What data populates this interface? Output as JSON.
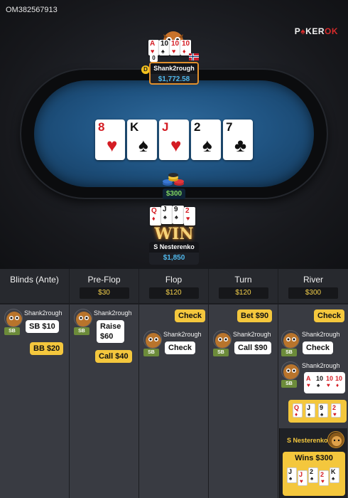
{
  "hand_id": "OM382567913",
  "brand": {
    "part1": "P",
    "part2": "KER",
    "ok": "OK"
  },
  "board": [
    {
      "rank": "8",
      "suit": "♥",
      "color": "red"
    },
    {
      "rank": "K",
      "suit": "♠",
      "color": "black"
    },
    {
      "rank": "J",
      "suit": "♥",
      "color": "red"
    },
    {
      "rank": "2",
      "suit": "♠",
      "color": "black"
    },
    {
      "rank": "7",
      "suit": "♣",
      "color": "black"
    }
  ],
  "villain": {
    "name": "Shank2rough",
    "stack": "$1,772.58",
    "dealer_label": "D",
    "cards": [
      {
        "rank": "A",
        "suit": "♥",
        "color": "red"
      },
      {
        "rank": "10",
        "suit": "♠",
        "color": "black"
      },
      {
        "rank": "10",
        "suit": "♥",
        "color": "red"
      },
      {
        "rank": "10",
        "suit": "♦",
        "color": "red"
      }
    ]
  },
  "hero": {
    "name": "S Nesterenko",
    "stack": "$1,850",
    "win_label": "WIN",
    "cards": [
      {
        "rank": "Q",
        "suit": "♦",
        "color": "red"
      },
      {
        "rank": "J",
        "suit": "♠",
        "color": "black"
      },
      {
        "rank": "9",
        "suit": "♠",
        "color": "black"
      },
      {
        "rank": "2",
        "suit": "♥",
        "color": "red"
      }
    ]
  },
  "pot": "$300",
  "history": {
    "columns": [
      {
        "title": "Blinds (Ante)",
        "pot": ""
      },
      {
        "title": "Pre-Flop",
        "pot": "$30"
      },
      {
        "title": "Flop",
        "pot": "$120"
      },
      {
        "title": "Turn",
        "pot": "$120"
      },
      {
        "title": "River",
        "pot": "$300"
      }
    ],
    "player_a": "Shank2rough",
    "position": "SB",
    "actions": {
      "blinds_sb": "SB $10",
      "blinds_bb": "BB $20",
      "preflop_raise": "Raise\n$60",
      "preflop_call": "Call $40",
      "flop_hero": "Check",
      "flop_villain": "Check",
      "turn_hero": "Bet $90",
      "turn_villain": "Call $90",
      "river_hero": "Check",
      "river_villain": "Check"
    },
    "winner": {
      "name": "S Nesterenko",
      "label": "Wins $300"
    }
  },
  "colors": {
    "accent": "#f4c73d",
    "stack": "#4fb8ec",
    "pot": "#7fd45f",
    "felt": "#1f5381"
  }
}
